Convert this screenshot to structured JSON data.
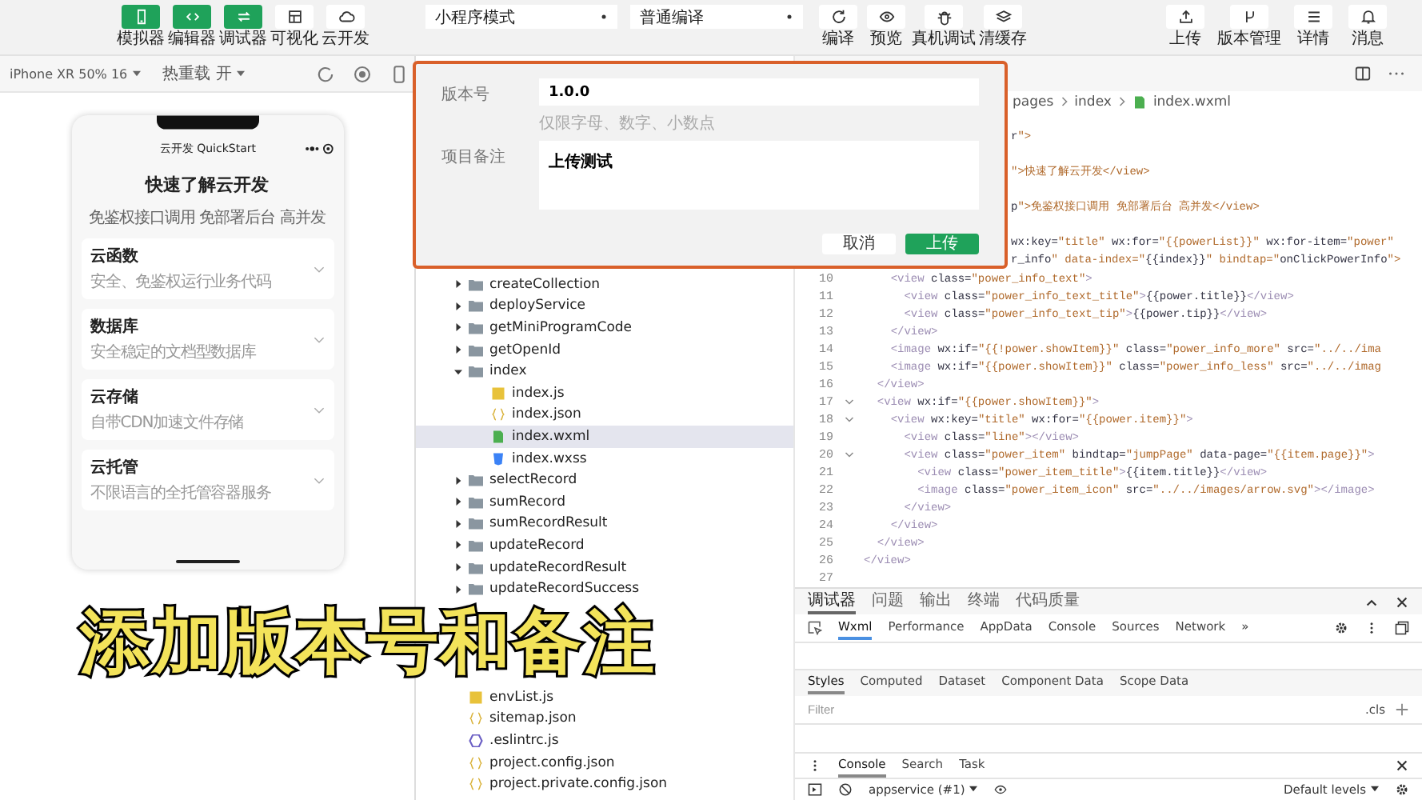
{
  "toolbar": {
    "views": [
      {
        "label": "模拟器",
        "on": true
      },
      {
        "label": "编辑器",
        "on": true
      },
      {
        "label": "调试器",
        "on": true
      },
      {
        "label": "可视化",
        "on": false
      },
      {
        "label": "云开发",
        "on": false
      }
    ],
    "mode_select": "小程序模式",
    "compile_select": "普通编译",
    "actions": [
      {
        "label": "编译"
      },
      {
        "label": "预览"
      },
      {
        "label": "真机调试"
      },
      {
        "label": "清缓存"
      }
    ],
    "right": [
      {
        "label": "上传"
      },
      {
        "label": "版本管理"
      },
      {
        "label": "详情"
      },
      {
        "label": "消息"
      }
    ]
  },
  "simulator": {
    "device": "iPhone XR 50% 16",
    "hot_reload": "热重载 开",
    "phone": {
      "nav_title": "云开发 QuickStart",
      "heading": "快速了解云开发",
      "subheading": "免鉴权接口调用 免部署后台 高并发",
      "cards": [
        {
          "title": "云函数",
          "desc": "安全、免鉴权运行业务代码"
        },
        {
          "title": "数据库",
          "desc": "安全稳定的文档型数据库"
        },
        {
          "title": "云存储",
          "desc": "自带CDN加速文件存储"
        },
        {
          "title": "云托管",
          "desc": "不限语言的全托管容器服务"
        }
      ]
    }
  },
  "file_tree": {
    "upper": [
      {
        "name": "createCollection",
        "kind": "folder",
        "expanded": false,
        "selected": false
      },
      {
        "name": "deployService",
        "kind": "folder",
        "expanded": false,
        "selected": false
      },
      {
        "name": "getMiniProgramCode",
        "kind": "folder",
        "expanded": false,
        "selected": false
      },
      {
        "name": "getOpenId",
        "kind": "folder",
        "expanded": false,
        "selected": false
      },
      {
        "name": "index",
        "kind": "folder",
        "expanded": true,
        "selected": false,
        "children": [
          {
            "name": "index.js",
            "kind": "js",
            "selected": false
          },
          {
            "name": "index.json",
            "kind": "json",
            "selected": false
          },
          {
            "name": "index.wxml",
            "kind": "wxml",
            "selected": true
          },
          {
            "name": "index.wxss",
            "kind": "wxss",
            "selected": false
          }
        ]
      },
      {
        "name": "selectRecord",
        "kind": "folder",
        "expanded": false,
        "selected": false
      },
      {
        "name": "sumRecord",
        "kind": "folder",
        "expanded": false,
        "selected": false
      },
      {
        "name": "sumRecordResult",
        "kind": "folder",
        "expanded": false,
        "selected": false
      },
      {
        "name": "updateRecord",
        "kind": "folder",
        "expanded": false,
        "selected": false
      },
      {
        "name": "updateRecordResult",
        "kind": "folder",
        "expanded": false,
        "selected": false
      },
      {
        "name": "updateRecordSuccess",
        "kind": "folder",
        "expanded": false,
        "selected": false
      }
    ],
    "lower": [
      {
        "name": "envList.js",
        "kind": "js",
        "selected": false
      },
      {
        "name": "sitemap.json",
        "kind": "json",
        "selected": false
      },
      {
        "name": ".eslintrc.js",
        "kind": "eslint",
        "selected": false
      },
      {
        "name": "project.config.json",
        "kind": "json",
        "selected": false
      },
      {
        "name": "project.private.config.json",
        "kind": "json",
        "selected": false
      }
    ]
  },
  "editor": {
    "breadcrumb": [
      "pages",
      "index",
      "index.wxml"
    ],
    "fragments": [
      "r\">",
      "\">快速了解云开发</view>",
      "p\">免鉴权接口调用 免部署后台 高并发</view>",
      "wx:key=\"title\" wx:for=\"{{powerList}}\" wx:for-item=\"power\"",
      "r_info\" data-index=\"{{index}}\" bindtap=\"onClickPowerInfo\">"
    ],
    "lines": [
      {
        "number": "10",
        "code": "    <view class=\"power_info_text\">",
        "fold": false
      },
      {
        "number": "11",
        "code": "      <view class=\"power_info_text_title\">{{power.title}}</view>",
        "fold": false
      },
      {
        "number": "12",
        "code": "      <view class=\"power_info_text_tip\">{{power.tip}}</view>",
        "fold": false
      },
      {
        "number": "13",
        "code": "    </view>",
        "fold": false
      },
      {
        "number": "14",
        "code": "    <image wx:if=\"{{!power.showItem}}\" class=\"power_info_more\" src=\"../../ima",
        "fold": false
      },
      {
        "number": "15",
        "code": "    <image wx:if=\"{{power.showItem}}\" class=\"power_info_less\" src=\"../../imag",
        "fold": false
      },
      {
        "number": "16",
        "code": "  </view>",
        "fold": false
      },
      {
        "number": "17",
        "code": "  <view wx:if=\"{{power.showItem}}\">",
        "fold": true
      },
      {
        "number": "18",
        "code": "    <view wx:key=\"title\" wx:for=\"{{power.item}}\">",
        "fold": true
      },
      {
        "number": "19",
        "code": "      <view class=\"line\"></view>",
        "fold": false
      },
      {
        "number": "20",
        "code": "      <view class=\"power_item\" bindtap=\"jumpPage\" data-page=\"{{item.page}}\">",
        "fold": true
      },
      {
        "number": "21",
        "code": "        <view class=\"power_item_title\">{{item.title}}</view>",
        "fold": false
      },
      {
        "number": "22",
        "code": "        <image class=\"power_item_icon\" src=\"../../images/arrow.svg\"></image>",
        "fold": false
      },
      {
        "number": "23",
        "code": "      </view>",
        "fold": false
      },
      {
        "number": "24",
        "code": "    </view>",
        "fold": false
      },
      {
        "number": "25",
        "code": "  </view>",
        "fold": false
      },
      {
        "number": "26",
        "code": "</view>",
        "fold": false
      },
      {
        "number": "27",
        "fold": false
      }
    ]
  },
  "dialog": {
    "fields": [
      {
        "kind": "input",
        "label": "版本号",
        "value": "1.0.0",
        "hint": "仅限字母、数字、小数点"
      },
      {
        "kind": "textarea",
        "label": "项目备注",
        "value": "上传测试"
      }
    ],
    "buttons": [
      {
        "label": "取消",
        "primary": false
      },
      {
        "label": "上传",
        "primary": true
      }
    ]
  },
  "caption": "添加版本号和备注",
  "debugger": {
    "tabs": [
      {
        "label": "调试器",
        "selected": true
      },
      {
        "label": "问题",
        "selected": false
      },
      {
        "label": "输出",
        "selected": false
      },
      {
        "label": "终端",
        "selected": false
      },
      {
        "label": "代码质量",
        "selected": false
      }
    ],
    "panels": [
      {
        "label": "Wxml",
        "selected": true
      },
      {
        "label": "Performance",
        "selected": false
      },
      {
        "label": "AppData",
        "selected": false
      },
      {
        "label": "Console",
        "selected": false
      },
      {
        "label": "Sources",
        "selected": false
      },
      {
        "label": "Network",
        "selected": false
      }
    ],
    "more": "»",
    "style_tabs": [
      {
        "label": "Styles",
        "selected": true
      },
      {
        "label": "Computed",
        "selected": false
      },
      {
        "label": "Dataset",
        "selected": false
      },
      {
        "label": "Component Data",
        "selected": false
      },
      {
        "label": "Scope Data",
        "selected": false
      }
    ],
    "filter_placeholder": "Filter",
    "cls": ".cls",
    "drawer_tabs": [
      {
        "label": "Console",
        "selected": true
      },
      {
        "label": "Search",
        "selected": false
      },
      {
        "label": "Task",
        "selected": false
      }
    ],
    "context": "appservice (#1)",
    "levels": "Default levels"
  }
}
